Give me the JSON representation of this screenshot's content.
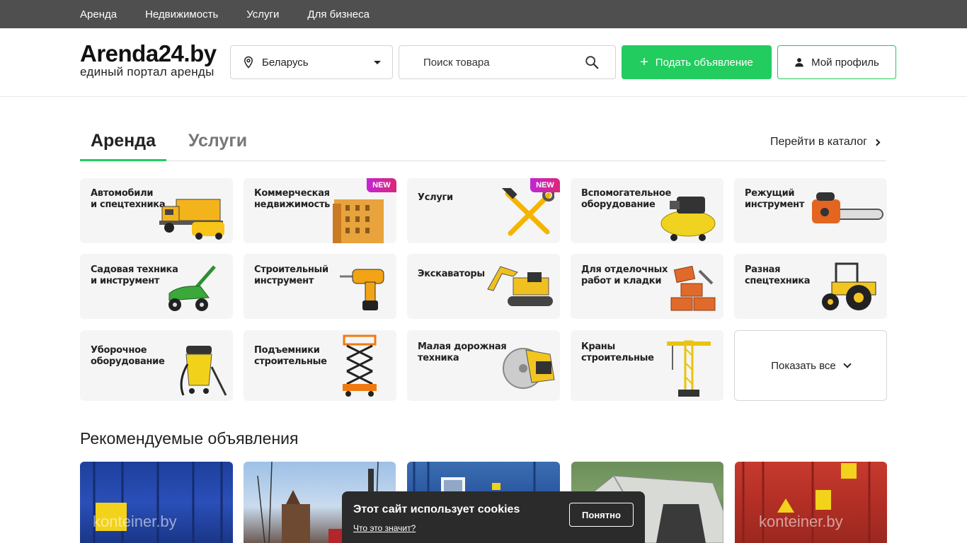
{
  "topnav": {
    "items": [
      "Аренда",
      "Недвижимость",
      "Услуги",
      "Для бизнеса"
    ]
  },
  "header": {
    "logo_title": "Arenda24.by",
    "logo_subtitle": "единый портал аренды",
    "region": "Беларусь",
    "search_placeholder": "Поиск товара",
    "post_button": "Подать объявление",
    "profile_button": "Мой профиль"
  },
  "tabs": {
    "active": "Аренда",
    "inactive": "Услуги",
    "catalog_link": "Перейти в каталог"
  },
  "categories": [
    {
      "line1": "Автомобили",
      "line2": "и спецтехника",
      "badge": ""
    },
    {
      "line1": "Коммерческая",
      "line2": "недвижимость",
      "badge": "NEW"
    },
    {
      "line1": "Услуги",
      "line2": "",
      "badge": "NEW"
    },
    {
      "line1": "Вспомогательное",
      "line2": "оборудование",
      "badge": ""
    },
    {
      "line1": "Режущий",
      "line2": "инструмент",
      "badge": ""
    },
    {
      "line1": "Садовая техника",
      "line2": "и инструмент",
      "badge": ""
    },
    {
      "line1": "Строительный",
      "line2": "инструмент",
      "badge": ""
    },
    {
      "line1": "Экскаваторы",
      "line2": "",
      "badge": ""
    },
    {
      "line1": "Для отделочных",
      "line2": "работ и кладки",
      "badge": ""
    },
    {
      "line1": "Разная",
      "line2": "спецтехника",
      "badge": ""
    },
    {
      "line1": "Уборочное",
      "line2": "оборудование",
      "badge": ""
    },
    {
      "line1": "Подъемники",
      "line2": "строительные",
      "badge": ""
    },
    {
      "line1": "Малая дорожная",
      "line2": "техника",
      "badge": ""
    },
    {
      "line1": "Краны",
      "line2": "строительные",
      "badge": ""
    }
  ],
  "show_all": "Показать все",
  "recommended": {
    "title": "Рекомендуемые объявления",
    "watermarks": [
      "konteiner.by",
      "",
      "",
      "",
      "konteiner.by"
    ]
  },
  "cookie": {
    "title": "Этот сайт использует cookies",
    "link": "Что это значит?",
    "button": "Понятно"
  },
  "colors": {
    "accent": "#22cc5e",
    "topnav_bg": "#4f4f4f",
    "card_bg": "#f5f5f5"
  }
}
